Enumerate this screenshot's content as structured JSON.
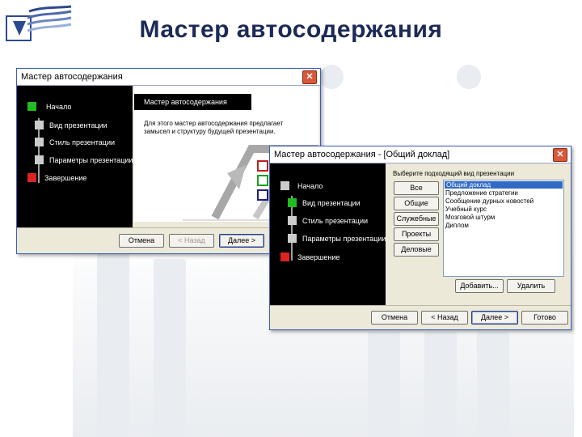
{
  "page_title": "Мастер автосодержания",
  "colors": {
    "title": "#1c2a55",
    "xp_border": "#3b5fb8",
    "step_done": "#cccccc",
    "step_current": "#22bb22",
    "step_last": "#dd2222"
  },
  "window1": {
    "title": "Мастер автосодержания",
    "steps": [
      "Начало",
      "Вид презентации",
      "Стиль презентации",
      "Параметры презентации",
      "Завершение"
    ],
    "heading": "Мастер автосодержания",
    "description": "Для этого мастер автосодержания предлагает замысел и структуру будущей презентации.",
    "buttons": {
      "cancel": "Отмена",
      "back": "< Назад",
      "next": "Далее >"
    }
  },
  "window2": {
    "title": "Мастер автосодержания - [Общий доклад]",
    "steps": [
      "Начало",
      "Вид презентации",
      "Стиль презентации",
      "Параметры презентации",
      "Завершение"
    ],
    "prompt": "Выберите подходящий вид презентации",
    "categories": [
      "Все",
      "Общие",
      "Служебные",
      "Проекты",
      "Деловые"
    ],
    "presentation_types": [
      "Общий доклад",
      "Предложение стратегии",
      "Сообщение дурных новостей",
      "Учебный курс",
      "Мозговой штурм",
      "Диплом"
    ],
    "selected_type": "Общий доклад",
    "add_button": "Добавить...",
    "remove_button": "Удалить",
    "buttons": {
      "cancel": "Отмена",
      "back": "< Назад",
      "next": "Далее >",
      "finish": "Готово"
    }
  }
}
